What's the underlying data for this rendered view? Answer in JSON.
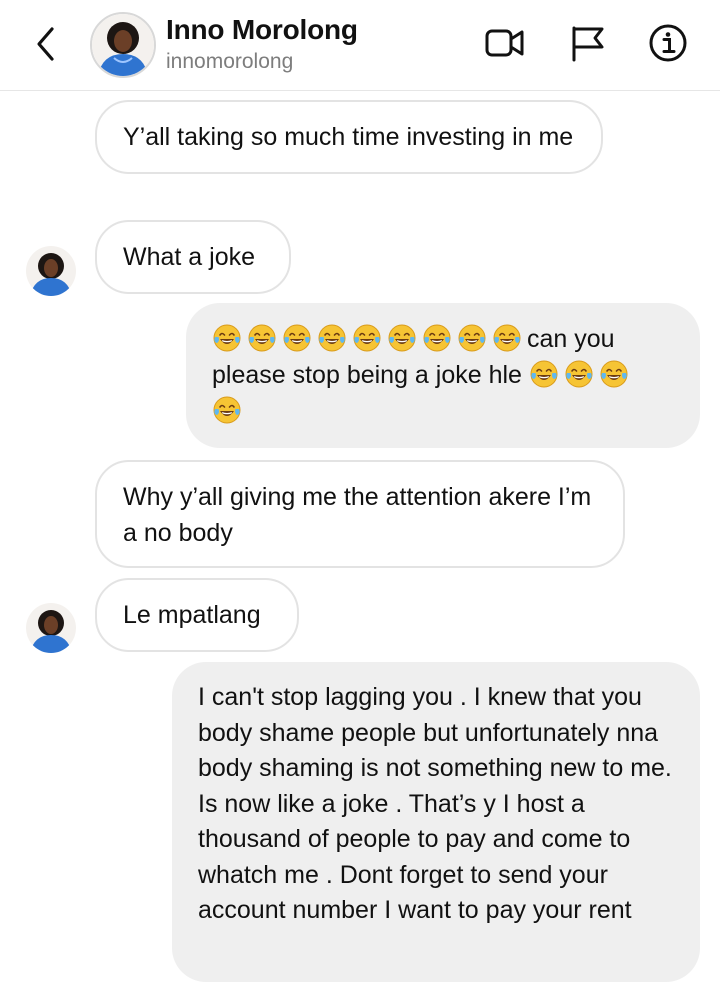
{
  "header": {
    "contact_name": "Inno Morolong",
    "username": "innomorolong",
    "icons": [
      "back-chevron-icon",
      "video-call-icon",
      "flag-icon",
      "info-icon"
    ]
  },
  "messages": [
    {
      "direction": "incoming",
      "text": "Y’all taking so much time investing in me"
    },
    {
      "direction": "incoming",
      "text": "What a joke"
    },
    {
      "direction": "outgoing",
      "text_after_emojis": "can you please stop being a joke hle",
      "emoji": "face-with-tears-of-joy",
      "emoji_counts": [
        9,
        3,
        1
      ]
    },
    {
      "direction": "incoming",
      "text": "Why y’all giving me the attention akere I’m a no body"
    },
    {
      "direction": "incoming",
      "text": "Le mpatlang"
    },
    {
      "direction": "outgoing",
      "text": "I can't stop lagging you  . I knew that you body shame people but unfortunately nna body shaming is not something new to me. Is now like a joke . That’s y I  host a thousand of people to pay and come to whatch me . Dont forget to send your account number I want to pay your rent"
    }
  ],
  "colors": {
    "outgoing_bubble": "#efefef",
    "incoming_border": "#e3e3e3",
    "avatar_outfit": "#2f74d0"
  }
}
